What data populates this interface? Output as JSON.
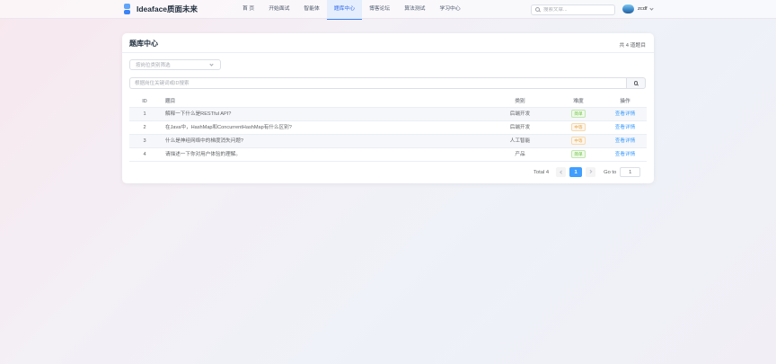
{
  "header": {
    "brand": "Ideaface质面未来",
    "nav": [
      {
        "label": "首 页"
      },
      {
        "label": "开始面试"
      },
      {
        "label": "智能体"
      },
      {
        "label": "题库中心",
        "active": true
      },
      {
        "label": "博客论坛"
      },
      {
        "label": "算法测试"
      },
      {
        "label": "学习中心"
      }
    ],
    "search_placeholder": "搜索文章...",
    "username": "zcdf"
  },
  "card": {
    "title": "题库中心",
    "count_text": "共 4 道题目",
    "category_placeholder": "按岗位类别筛选",
    "keyword_placeholder": "根据岗位关键词或ID搜索"
  },
  "table": {
    "columns": {
      "id": "ID",
      "title": "题目",
      "category": "类别",
      "difficulty": "难度",
      "action": "操作"
    },
    "rows": [
      {
        "id": "1",
        "title": "解释一下什么是RESTful API?",
        "category": "后端开发",
        "difficulty": "简单",
        "level": "easy",
        "action": "查看详情"
      },
      {
        "id": "2",
        "title": "在Java中，HashMap和ConcurrentHashMap有什么区别?",
        "category": "后端开发",
        "difficulty": "中等",
        "level": "medium",
        "action": "查看详情"
      },
      {
        "id": "3",
        "title": "什么是神经网络中的梯度消失问题?",
        "category": "人工智能",
        "difficulty": "中等",
        "level": "medium",
        "action": "查看详情"
      },
      {
        "id": "4",
        "title": "请描述一下你对用户体验的理解。",
        "category": "产品",
        "difficulty": "简单",
        "level": "easy",
        "action": "查看详情"
      }
    ]
  },
  "pagination": {
    "total_text": "Total 4",
    "current_page": "1",
    "goto_label": "Go to",
    "goto_value": "1"
  },
  "colors": {
    "primary": "#409eff",
    "nav_active": "#2563eb",
    "easy": "#67c23a",
    "medium": "#e6a23c"
  }
}
